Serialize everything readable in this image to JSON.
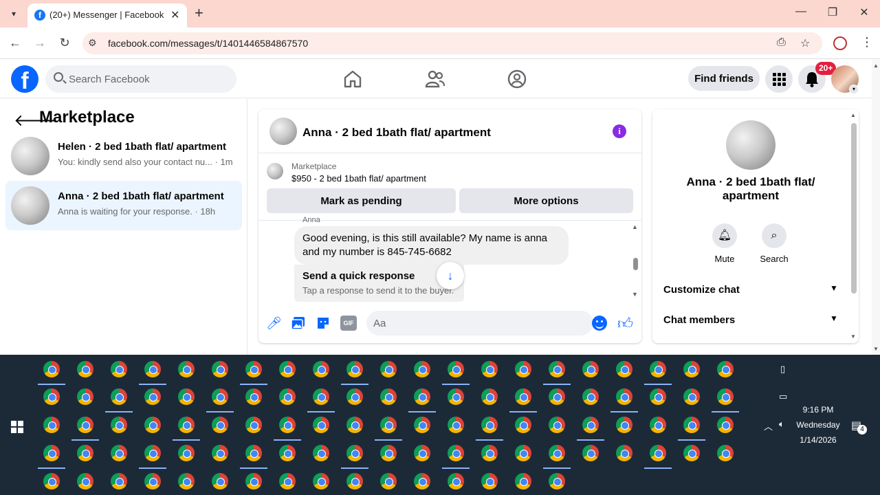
{
  "browser": {
    "tab_title": "(20+) Messenger | Facebook",
    "tab_favicon": "f",
    "url": "facebook.com/messages/t/1401446584867570",
    "accent": "#fbd7cf"
  },
  "fb": {
    "logo": "f",
    "search_placeholder": "Search Facebook",
    "find_friends_label": "Find friends",
    "notification_badge": "20+",
    "brand_color": "#0866ff"
  },
  "left_panel": {
    "title": "Marketplace",
    "conversations": [
      {
        "name": "Helen · 2 bed 1bath flat/ apartment",
        "preview": "You: kindly send also your contact nu... · 1m",
        "active": false
      },
      {
        "name": "Anna · 2 bed 1bath flat/ apartment",
        "preview": "Anna is waiting for your response. · 18h",
        "active": true
      }
    ]
  },
  "chat": {
    "title": "Anna · 2 bed 1bath flat/ apartment",
    "marketplace_label": "Marketplace",
    "listing": "$950 - 2 bed 1bath flat/ apartment",
    "mark_pending_label": "Mark as pending",
    "more_options_label": "More options",
    "sender": "Anna",
    "message": "Good evening, is this still available? My name is anna and my number is 845-745-6682",
    "quick_title": "Send a quick response",
    "quick_sub": "Tap a response to send it to the buyer.",
    "composer_placeholder": "Aa",
    "gif_label": "GIF"
  },
  "info_panel": {
    "name": "Anna · 2 bed 1bath flat/ apartment",
    "mute_label": "Mute",
    "search_label": "Search",
    "customize_label": "Customize chat",
    "members_label": "Chat members"
  },
  "taskbar": {
    "time": "9:16 PM",
    "day": "Wednesday",
    "date": "1/14/2026",
    "notification_count": "4"
  }
}
